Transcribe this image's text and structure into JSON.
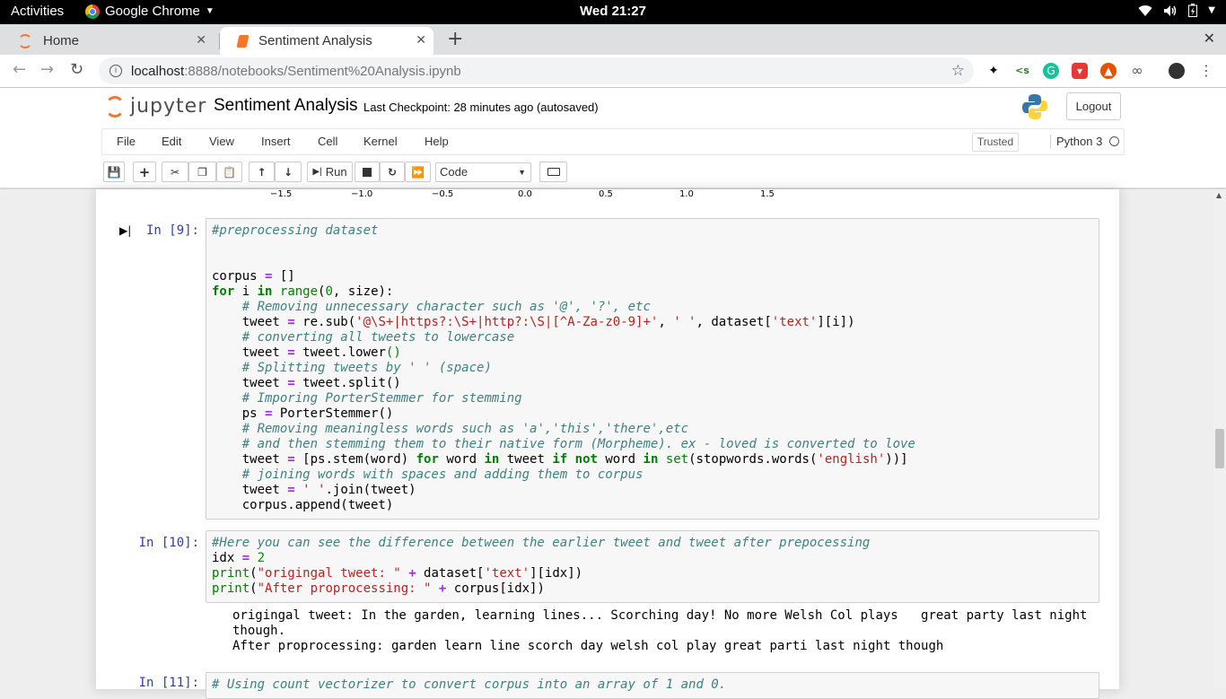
{
  "system_bar": {
    "activities": "Activities",
    "app_name": "Google Chrome",
    "clock": "Wed 21:27"
  },
  "browser": {
    "tabs": [
      {
        "title": "Home",
        "active": false
      },
      {
        "title": "Sentiment Analysis",
        "active": true
      }
    ],
    "url_host": "localhost",
    "url_path": ":8888/notebooks/Sentiment%20Analysis.ipynb"
  },
  "jupyter": {
    "logo_text": "jupyter",
    "notebook_title": "Sentiment Analysis",
    "checkpoint_text": "Last Checkpoint: 28 minutes ago",
    "autosave_text": "(autosaved)",
    "logout_label": "Logout",
    "menu": [
      "File",
      "Edit",
      "View",
      "Insert",
      "Cell",
      "Kernel",
      "Help"
    ],
    "trusted_label": "Trusted",
    "kernel_name": "Python 3",
    "run_label": "Run",
    "cell_type": "Code"
  },
  "plot_axis_ticks": [
    "−1.5",
    "−1.0",
    "−0.5",
    "0.0",
    "0.5",
    "1.0",
    "1.5"
  ],
  "cells": [
    {
      "prompt": "In [9]:",
      "code": "#preprocessing dataset\n\n\ncorpus = []\nfor i in range(0, size):\n    # Removing unnecessary character such as '@', '?', etc\n    tweet = re.sub('@\\S+|https?:\\S+|http?:\\S|[^A-Za-z0-9]+', ' ', dataset['text'][i])\n    # converting all tweets to lowercase\n    tweet = tweet.lower()\n    # Splitting tweets by ' ' (space)\n    tweet = tweet.split()\n    # Imporing PorterStemmer for stemming\n    ps = PorterStemmer()\n    # Removing meaningless words such as 'a','this','there',etc\n    # and then stemming them to their native form (Morpheme). ex - loved is converted to love\n    tweet = [ps.stem(word) for word in tweet if not word in set(stopwords.words('english'))]\n    # joining words with spaces and adding them to corpus\n    tweet = ' '.join(tweet)\n    corpus.append(tweet)"
    },
    {
      "prompt": "In [10]:",
      "code": "#Here you can see the difference between the earlier tweet and tweet after prepocessing\nidx = 2\nprint(\"origingal tweet: \" + dataset['text'][idx])\nprint(\"After proprocessing: \" + corpus[idx])",
      "output": "origingal tweet: In the garden, learning lines... Scorching day! No more Welsh Col plays   great party last night\nthough.\nAfter proprocessing: garden learn line scorch day welsh col play great parti last night though"
    },
    {
      "prompt": "In [11]:",
      "code": "# Using count vectorizer to convert corpus into an array of 1 and 0."
    }
  ]
}
